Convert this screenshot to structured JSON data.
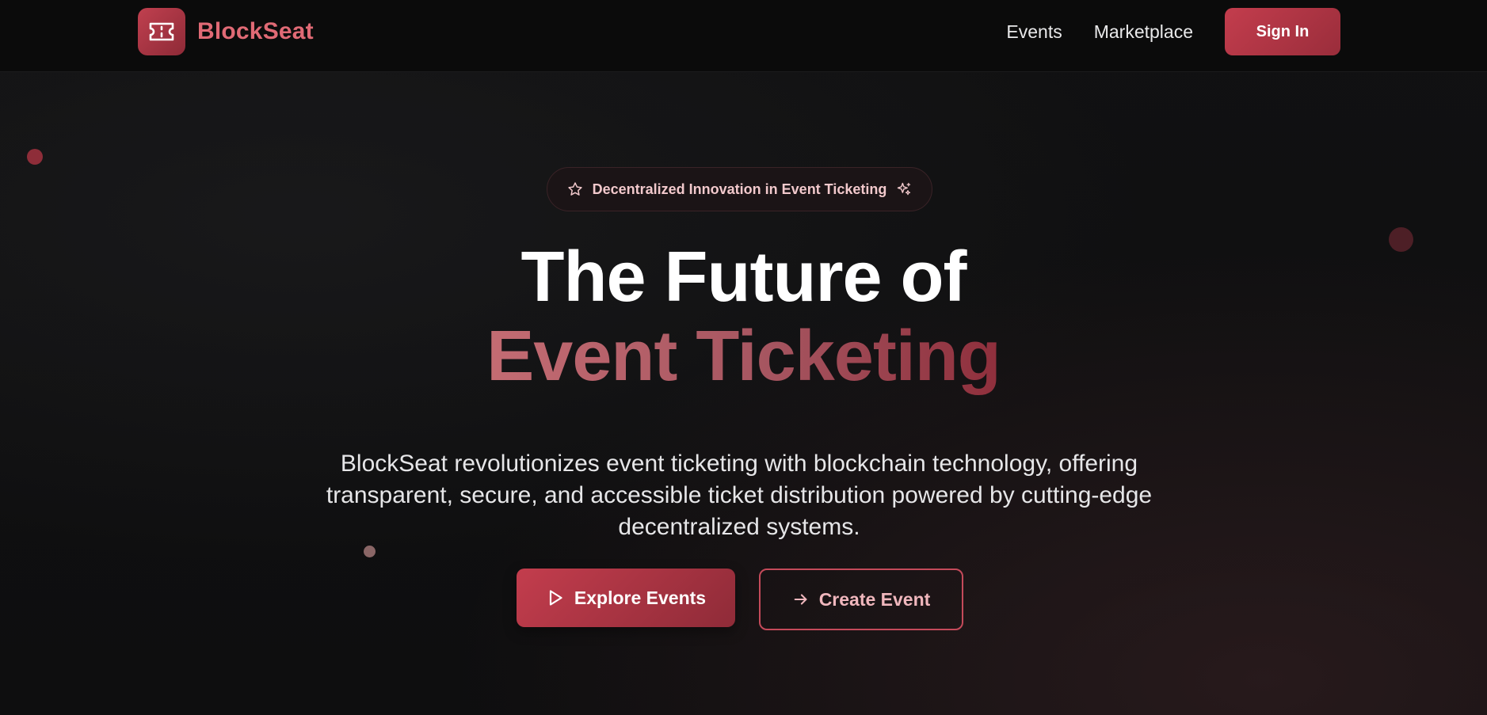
{
  "brand": {
    "name": "BlockSeat",
    "logo_icon": "ticket-icon"
  },
  "nav": {
    "links": [
      "Events",
      "Marketplace"
    ],
    "signin_label": "Sign In"
  },
  "hero": {
    "badge_text": "Decentralized Innovation in Event Ticketing",
    "badge_icon_left": "star-icon",
    "badge_icon_right": "sparkles-icon",
    "title_line1": "The Future of",
    "title_line2": "Event Ticketing",
    "description": "BlockSeat revolutionizes event ticketing with blockchain technology, offering transparent, secure, and accessible ticket distribution powered by cutting-edge decentralized systems.",
    "primary_button": {
      "label": "Explore Events",
      "icon": "play-icon"
    },
    "secondary_button": {
      "label": "Create Event",
      "icon": "arrow-right-icon"
    }
  },
  "colors": {
    "accent": "#c33d4d",
    "accent_dark": "#8f2b38",
    "brand_text": "#e06a75",
    "background": "#0f0f10"
  }
}
